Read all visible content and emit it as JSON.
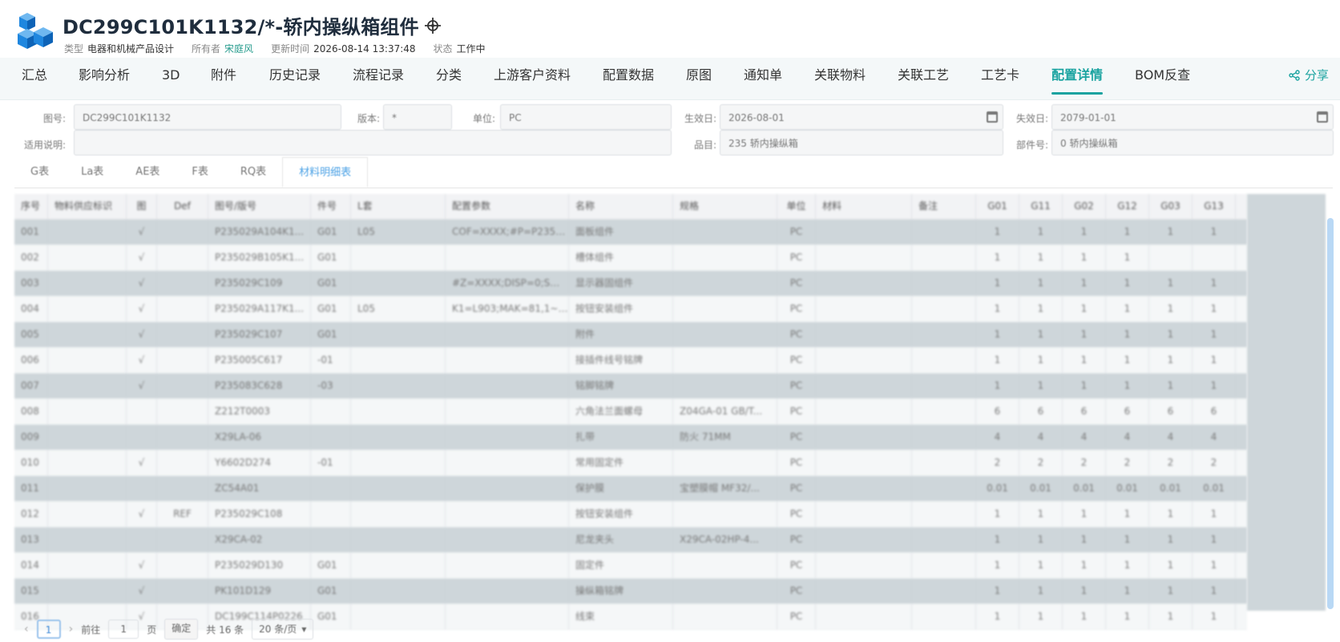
{
  "header": {
    "title": "DC299C101K1132/*-轿内操纵箱组件",
    "meta": [
      {
        "key": "类型",
        "value": "电器和机械产品设计"
      },
      {
        "key": "所有者",
        "value": "宋庭风"
      },
      {
        "key": "更新时间",
        "value": "2026-08-14 13:37:48"
      },
      {
        "key": "状态",
        "value": "工作中"
      }
    ]
  },
  "tabs": [
    "汇总",
    "影响分析",
    "3D",
    "附件",
    "历史记录",
    "流程记录",
    "分类",
    "上游客户资料",
    "配置数据",
    "原图",
    "通知单",
    "关联物料",
    "关联工艺",
    "工艺卡",
    "配置详情",
    "BOM反查"
  ],
  "active_tab": "配置详情",
  "share_label": "分享",
  "form": {
    "drawing_no_label": "图号:",
    "drawing_no": "DC299C101K1132",
    "version_label": "版本:",
    "version": "*",
    "unit_label": "单位:",
    "unit": "PC",
    "effective_label": "生效日:",
    "effective": "2026-08-01",
    "expire_label": "失效日:",
    "expire": "2079-01-01",
    "usage_label": "适用说明:",
    "product_label": "品目:",
    "product": "235 轿内操纵箱",
    "part_label": "部件号:",
    "part": "0 轿内操纵箱"
  },
  "subtabs": [
    "G表",
    "La表",
    "AE表",
    "F表",
    "RQ表",
    "材料明细表"
  ],
  "active_subtab": "材料明细表",
  "table": {
    "columns": [
      "序号",
      "物料供应标识",
      "图",
      "Def",
      "图号/版号",
      "件号",
      "L套",
      "配置参数",
      "名称",
      "规格",
      "单位",
      "材料",
      "备注",
      "G01",
      "G11",
      "G02",
      "G12",
      "G03",
      "G13"
    ],
    "rows": [
      [
        "001",
        "",
        "√",
        "",
        "P235029A104K1...",
        "G01",
        "L05",
        "COF=XXXX;#P=P23502...",
        "面板组件",
        "",
        "PC",
        "",
        "",
        "1",
        "1",
        "1",
        "1",
        "1",
        "1"
      ],
      [
        "002",
        "",
        "√",
        "",
        "P235029B105K1...",
        "G01",
        "",
        "",
        "槽体组件",
        "",
        "PC",
        "",
        "",
        "1",
        "1",
        "1",
        "1",
        "",
        ""
      ],
      [
        "003",
        "",
        "√",
        "",
        "P235029C109",
        "G01",
        "",
        "#Z=XXXX;DISP=0;SW=...",
        "显示器固组件",
        "",
        "PC",
        "",
        "",
        "1",
        "1",
        "1",
        "1",
        "1",
        "1"
      ],
      [
        "004",
        "",
        "√",
        "",
        "P235029A117K1...",
        "G01",
        "L05",
        "K1=L903;MAK=81,1~3,T",
        "按钮安装组件",
        "",
        "PC",
        "",
        "",
        "1",
        "1",
        "1",
        "1",
        "1",
        "1"
      ],
      [
        "005",
        "",
        "√",
        "",
        "P235029C107",
        "G01",
        "",
        "",
        "附件",
        "",
        "PC",
        "",
        "",
        "1",
        "1",
        "1",
        "1",
        "1",
        "1"
      ],
      [
        "006",
        "",
        "√",
        "",
        "P235005C617",
        "-01",
        "",
        "",
        "接插件线号铭牌",
        "",
        "PC",
        "",
        "",
        "1",
        "1",
        "1",
        "1",
        "1",
        "1"
      ],
      [
        "007",
        "",
        "√",
        "",
        "P235083C628",
        "-03",
        "",
        "",
        "铭脚铭牌",
        "",
        "PC",
        "",
        "",
        "1",
        "1",
        "1",
        "1",
        "1",
        "1"
      ],
      [
        "008",
        "",
        "",
        "",
        "Z212T0003",
        "",
        "",
        "",
        "六角法兰面螺母",
        "Z04GA-01 GB/T...",
        "PC",
        "",
        "",
        "6",
        "6",
        "6",
        "6",
        "6",
        "6"
      ],
      [
        "009",
        "",
        "",
        "",
        "X29LA-06",
        "",
        "",
        "",
        "扎带",
        "防火 71MM",
        "PC",
        "",
        "",
        "4",
        "4",
        "4",
        "4",
        "4",
        "4"
      ],
      [
        "010",
        "",
        "√",
        "",
        "Y6602D274",
        "-01",
        "",
        "",
        "常用固定件",
        "",
        "PC",
        "",
        "",
        "2",
        "2",
        "2",
        "2",
        "2",
        "2"
      ],
      [
        "011",
        "",
        "",
        "",
        "ZC54A01",
        "",
        "",
        "",
        "保护膜",
        "宝塑膜帽 MF32/...",
        "PC",
        "",
        "",
        "0.01",
        "0.01",
        "0.01",
        "0.01",
        "0.01",
        "0.01"
      ],
      [
        "012",
        "",
        "√",
        "REF",
        "P235029C108",
        "",
        "",
        "",
        "按钮安装组件",
        "",
        "PC",
        "",
        "",
        "1",
        "1",
        "1",
        "1",
        "1",
        "1"
      ],
      [
        "013",
        "",
        "",
        "",
        "X29CA-02",
        "",
        "",
        "",
        "尼龙夹头",
        "X29CA-02HP-4...",
        "PC",
        "",
        "",
        "1",
        "1",
        "1",
        "1",
        "1",
        "1"
      ],
      [
        "014",
        "",
        "√",
        "",
        "P235029D130",
        "G01",
        "",
        "",
        "固定件",
        "",
        "PC",
        "",
        "",
        "1",
        "1",
        "1",
        "1",
        "1",
        "1"
      ],
      [
        "015",
        "",
        "√",
        "",
        "PK101D129",
        "G01",
        "",
        "",
        "操纵箱铭牌",
        "",
        "PC",
        "",
        "",
        "1",
        "1",
        "1",
        "1",
        "1",
        "1"
      ],
      [
        "016",
        "",
        "√",
        "",
        "DC199C114P0226",
        "G01",
        "",
        "",
        "线束",
        "",
        "PC",
        "",
        "",
        "1",
        "1",
        "1",
        "1",
        "1",
        "1"
      ]
    ]
  },
  "pager": {
    "current_page": "1",
    "goto_label": "前往",
    "goto_value": "1",
    "page_unit": "页",
    "confirm_label": "确定",
    "total_label": "共 16 条",
    "page_size_label": "20 条/页"
  }
}
